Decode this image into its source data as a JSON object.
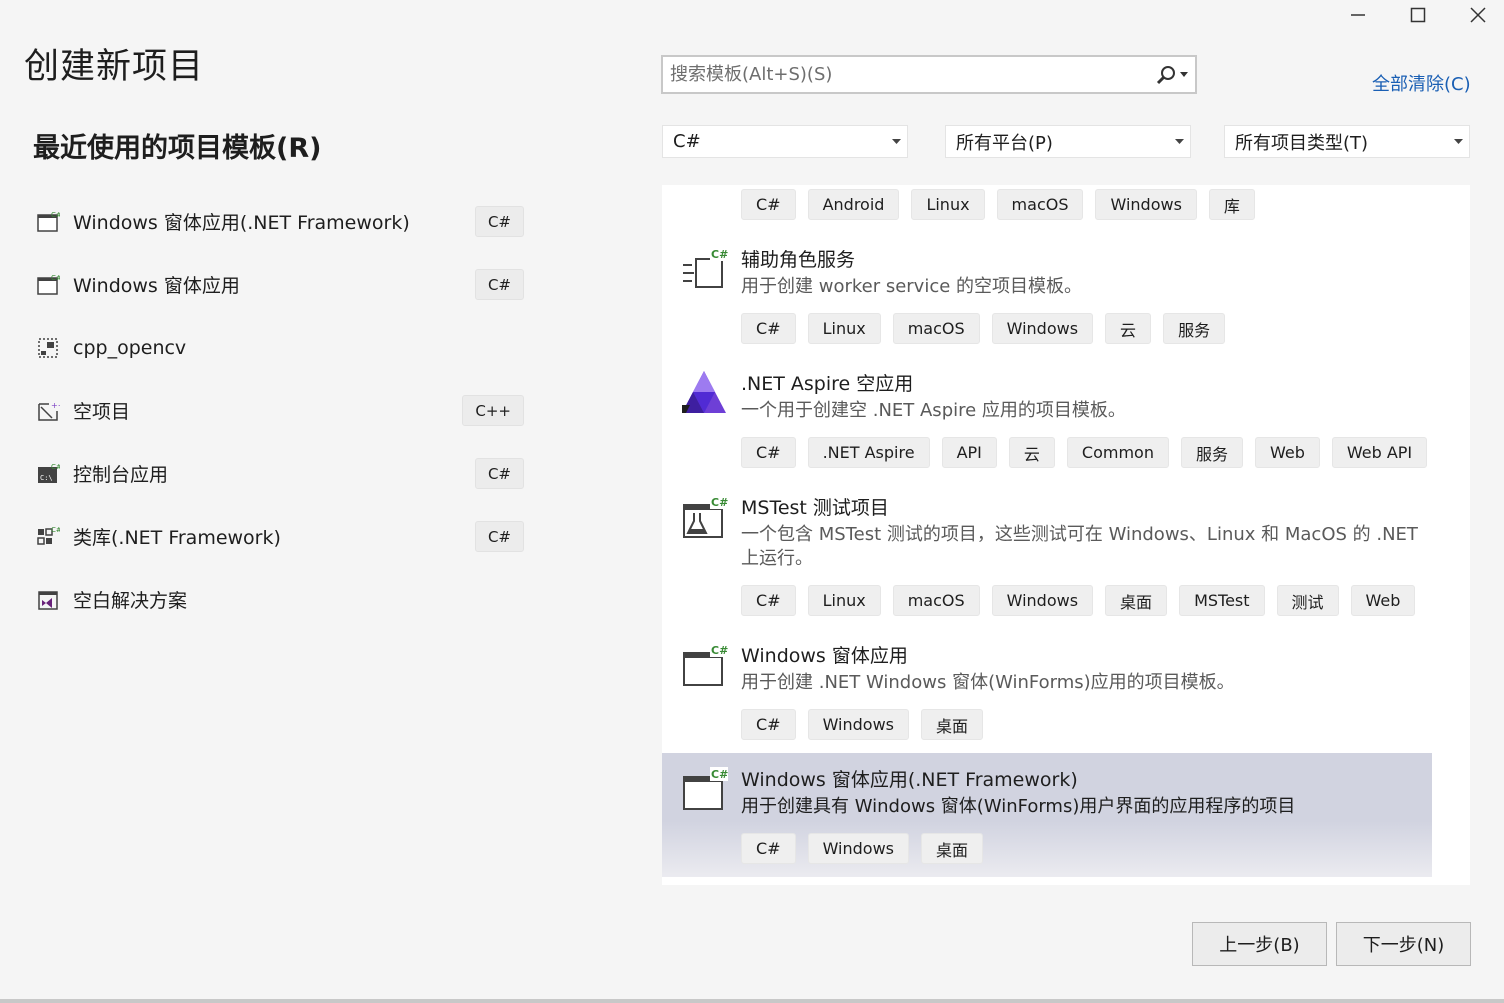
{
  "window": {
    "controls": [
      "minimize-icon",
      "maximize-icon",
      "close-icon"
    ]
  },
  "header": {
    "title": "创建新项目",
    "recent_title": "最近使用的项目模板(R)"
  },
  "recent": [
    {
      "label": "Windows 窗体应用(.NET Framework)",
      "lang": "C#",
      "icon": "winforms-icon"
    },
    {
      "label": "Windows 窗体应用",
      "lang": "C#",
      "icon": "winforms-icon"
    },
    {
      "label": "cpp_opencv",
      "lang": "",
      "icon": "custom-template-icon"
    },
    {
      "label": "空项目",
      "lang": "C++",
      "icon": "empty-project-icon"
    },
    {
      "label": "控制台应用",
      "lang": "C#",
      "icon": "console-app-icon"
    },
    {
      "label": "类库(.NET Framework)",
      "lang": "C#",
      "icon": "class-library-icon"
    },
    {
      "label": "空白解决方案",
      "lang": "",
      "icon": "blank-solution-icon"
    }
  ],
  "search": {
    "placeholder": "搜索模板(Alt+S)(S)",
    "value": ""
  },
  "clear_all": "全部清除(C)",
  "filters": {
    "language": "C#",
    "platform": "所有平台(P)",
    "project_type": "所有项目类型(T)"
  },
  "partial_tags": [
    "C#",
    "Android",
    "Linux",
    "macOS",
    "Windows",
    "库"
  ],
  "templates": [
    {
      "name": "辅助角色服务",
      "desc": "用于创建 worker service 的空项目模板。",
      "tags": [
        "C#",
        "Linux",
        "macOS",
        "Windows",
        "云",
        "服务"
      ],
      "icon": "worker-service-icon"
    },
    {
      "name": ".NET Aspire 空应用",
      "desc": "一个用于创建空 .NET Aspire 应用的项目模板。",
      "tags": [
        "C#",
        ".NET Aspire",
        "API",
        "云",
        "Common",
        "服务",
        "Web",
        "Web API"
      ],
      "icon": "aspire-icon"
    },
    {
      "name": "MSTest 测试项目",
      "desc": "一个包含 MSTest 测试的项目，这些测试可在 Windows、Linux 和 MacOS 的 .NET 上运行。",
      "tags": [
        "C#",
        "Linux",
        "macOS",
        "Windows",
        "桌面",
        "MSTest",
        "测试",
        "Web"
      ],
      "icon": "mstest-icon"
    },
    {
      "name": "Windows 窗体应用",
      "desc": "用于创建 .NET Windows 窗体(WinForms)应用的项目模板。",
      "tags": [
        "C#",
        "Windows",
        "桌面"
      ],
      "icon": "winforms-icon"
    },
    {
      "name": "Windows 窗体应用(.NET Framework)",
      "desc": "用于创建具有 Windows 窗体(WinForms)用户界面的应用程序的项目",
      "tags": [
        "C#",
        "Windows",
        "桌面"
      ],
      "icon": "winforms-icon",
      "selected": true
    }
  ],
  "buttons": {
    "back": "上一步(B)",
    "next": "下一步(N)"
  },
  "colors": {
    "link": "#1a5fb4",
    "selected_bg": "#d1d3e0",
    "csharp_badge": "#388a34",
    "aspire": "#6e3fd6"
  }
}
